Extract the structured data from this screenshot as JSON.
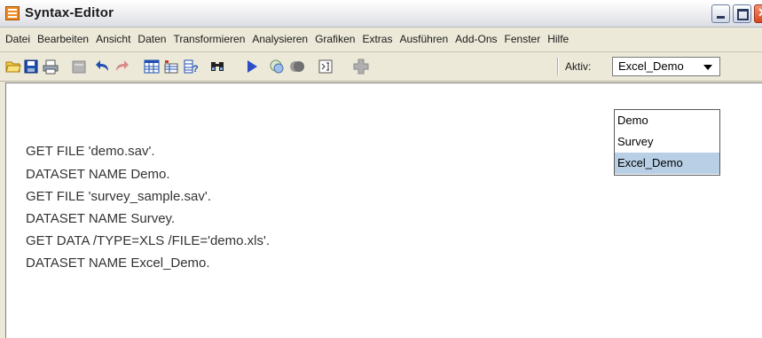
{
  "window": {
    "title": "Syntax-Editor"
  },
  "menu": [
    "Datei",
    "Bearbeiten",
    "Ansicht",
    "Daten",
    "Transformieren",
    "Analysieren",
    "Grafiken",
    "Extras",
    "Ausführen",
    "Add-Ons",
    "Fenster",
    "Hilfe"
  ],
  "toolbar": {
    "aktiv_label": "Aktiv:",
    "aktiv_value": "Excel_Demo",
    "icons": [
      "open-folder-icon",
      "save-icon",
      "print-icon",
      "recall-dialog-icon",
      "undo-icon",
      "redo-icon",
      "data-grid-icon",
      "variables-icon",
      "variable-info-icon",
      "find-icon",
      "run-icon",
      "syntax-help-icon",
      "bookmark-icon",
      "break-icon",
      "add-icon"
    ]
  },
  "dataset_options": [
    {
      "label": "Demo",
      "selected": false
    },
    {
      "label": "Survey",
      "selected": false
    },
    {
      "label": "Excel_Demo",
      "selected": true
    }
  ],
  "editor": {
    "lines": [
      "GET FILE 'demo.sav'.",
      "DATASET NAME Demo.",
      "GET FILE 'survey_sample.sav'.",
      "DATASET NAME Survey.",
      "GET DATA /TYPE=XLS /FILE='demo.xls'.",
      "DATASET NAME Excel_Demo."
    ]
  },
  "colors": {
    "selection": "#b8cfe5",
    "title_icon": "#f28b1e",
    "close_button": "#d8441c"
  }
}
